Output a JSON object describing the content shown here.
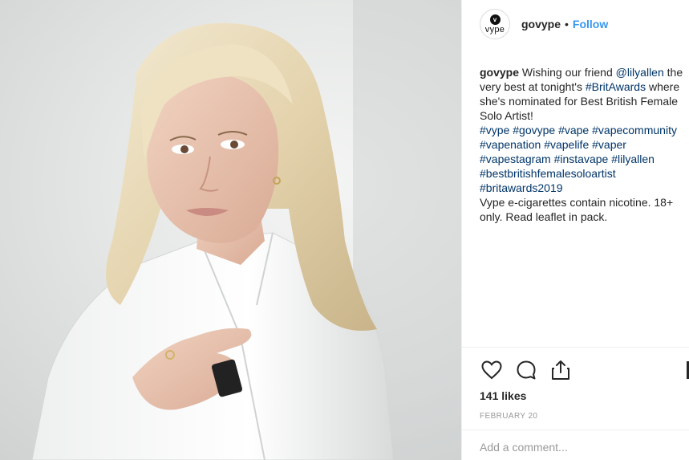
{
  "post": {
    "account": {
      "avatar_text": "vype",
      "handle": "govype",
      "separator": "•",
      "follow_label": "Follow"
    },
    "caption": {
      "username": "govype",
      "parts": {
        "p1": " Wishing our friend ",
        "mention": "@lilyallen",
        "p2": " the very best at tonight's ",
        "tag_brit": "#BritAwards",
        "p3": " where she's nominated for Best British Female Solo Artist!"
      },
      "hashtags": [
        "#vype",
        "#govype",
        "#vape",
        "#vapecommunity",
        "#vapenation",
        "#vapelife",
        "#vaper",
        "#vapestagram",
        "#instavape",
        "#lilyallen",
        "#bestbritishfemalesoloartist",
        "#britawards2019"
      ],
      "disclaimer": "Vype e-cigarettes contain nicotine. 18+ only. Read leaflet in pack."
    },
    "actions": [
      "heart-icon",
      "comment-icon",
      "share-icon"
    ],
    "likes": "141 likes",
    "date": "FEBRUARY 20",
    "comment_placeholder": "Add a comment..."
  },
  "colors": {
    "link": "#003569",
    "follow": "#3897f0",
    "muted": "#999999",
    "text": "#262626"
  }
}
